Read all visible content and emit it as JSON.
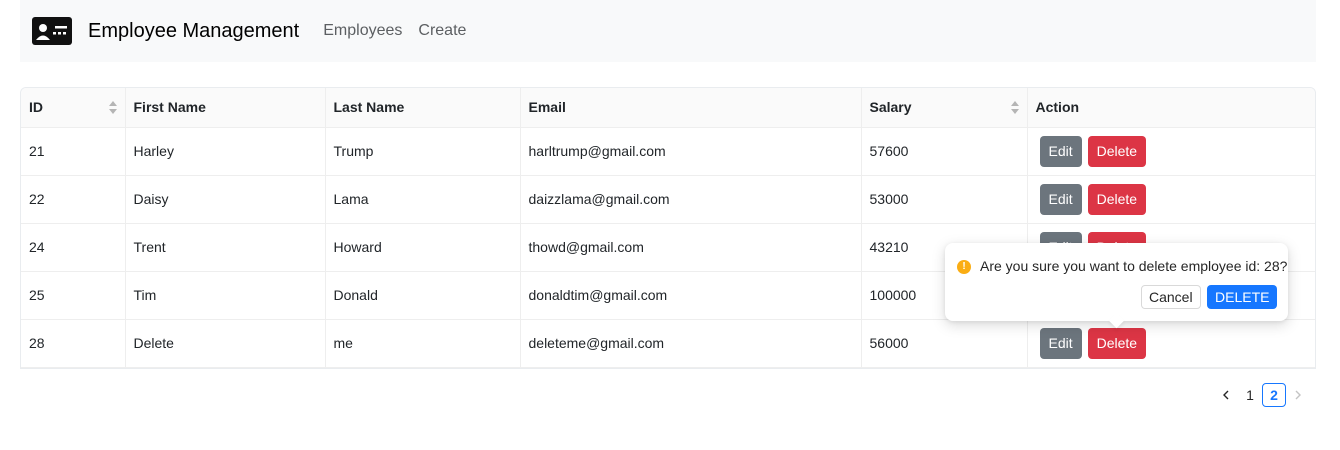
{
  "navbar": {
    "brand": "Employee Management",
    "links": [
      "Employees",
      "Create"
    ]
  },
  "table": {
    "headers": [
      "ID",
      "First Name",
      "Last Name",
      "Email",
      "Salary",
      "Action"
    ],
    "rows": [
      {
        "id": "21",
        "first": "Harley",
        "last": "Trump",
        "email": "harltrump@gmail.com",
        "salary": "57600"
      },
      {
        "id": "22",
        "first": "Daisy",
        "last": "Lama",
        "email": "daizzlama@gmail.com",
        "salary": "53000"
      },
      {
        "id": "24",
        "first": "Trent",
        "last": "Howard",
        "email": "thowd@gmail.com",
        "salary": "43210"
      },
      {
        "id": "25",
        "first": "Tim",
        "last": "Donald",
        "email": "donaldtim@gmail.com",
        "salary": "100000"
      },
      {
        "id": "28",
        "first": "Delete",
        "last": "me",
        "email": "deleteme@gmail.com",
        "salary": "56000"
      }
    ],
    "edit_label": "Edit",
    "delete_label": "Delete"
  },
  "popconfirm": {
    "icon": "exclamation-icon",
    "icon_glyph": "!",
    "message": "Are you sure you want to delete employee id: 28?",
    "cancel_label": "Cancel",
    "ok_label": "DELETE"
  },
  "pagination": {
    "pages": [
      "1",
      "2"
    ],
    "current": "2"
  },
  "colors": {
    "navbar_bg": "#f8f9fa",
    "edit_button": "#6c757d",
    "delete_button": "#dc3545",
    "primary": "#1677ff",
    "warning": "#faad14"
  }
}
